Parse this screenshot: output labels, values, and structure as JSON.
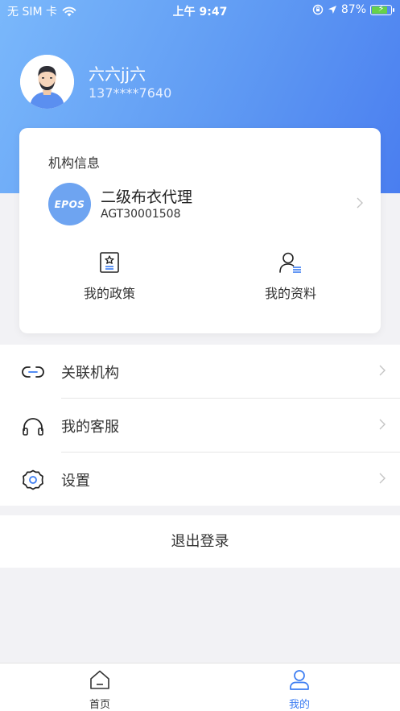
{
  "status_bar": {
    "carrier": "无 SIM 卡",
    "time": "上午 9:47",
    "battery_percent": "87%",
    "battery_level": 0.87
  },
  "profile": {
    "name": "六六jj六",
    "phone": "137****7640"
  },
  "org_card": {
    "title": "机构信息",
    "logo_text": "EPOS",
    "org_name": "二级布衣代理",
    "org_code": "AGT30001508",
    "shortcuts": [
      {
        "label": "我的政策",
        "icon": "policy-icon"
      },
      {
        "label": "我的资料",
        "icon": "profile-icon"
      }
    ]
  },
  "menu": {
    "items": [
      {
        "label": "关联机构",
        "icon": "link-icon"
      },
      {
        "label": "我的客服",
        "icon": "headset-icon"
      },
      {
        "label": "设置",
        "icon": "gear-icon"
      }
    ]
  },
  "logout_label": "退出登录",
  "tabbar": {
    "tabs": [
      {
        "label": "首页",
        "icon": "home-icon",
        "active": false
      },
      {
        "label": "我的",
        "icon": "user-icon",
        "active": true
      }
    ]
  },
  "colors": {
    "accent": "#3b7cf2",
    "header_gradient_start": "#7ab8fb",
    "header_gradient_end": "#4a7ef0",
    "org_logo_bg": "#6ea4f1"
  }
}
